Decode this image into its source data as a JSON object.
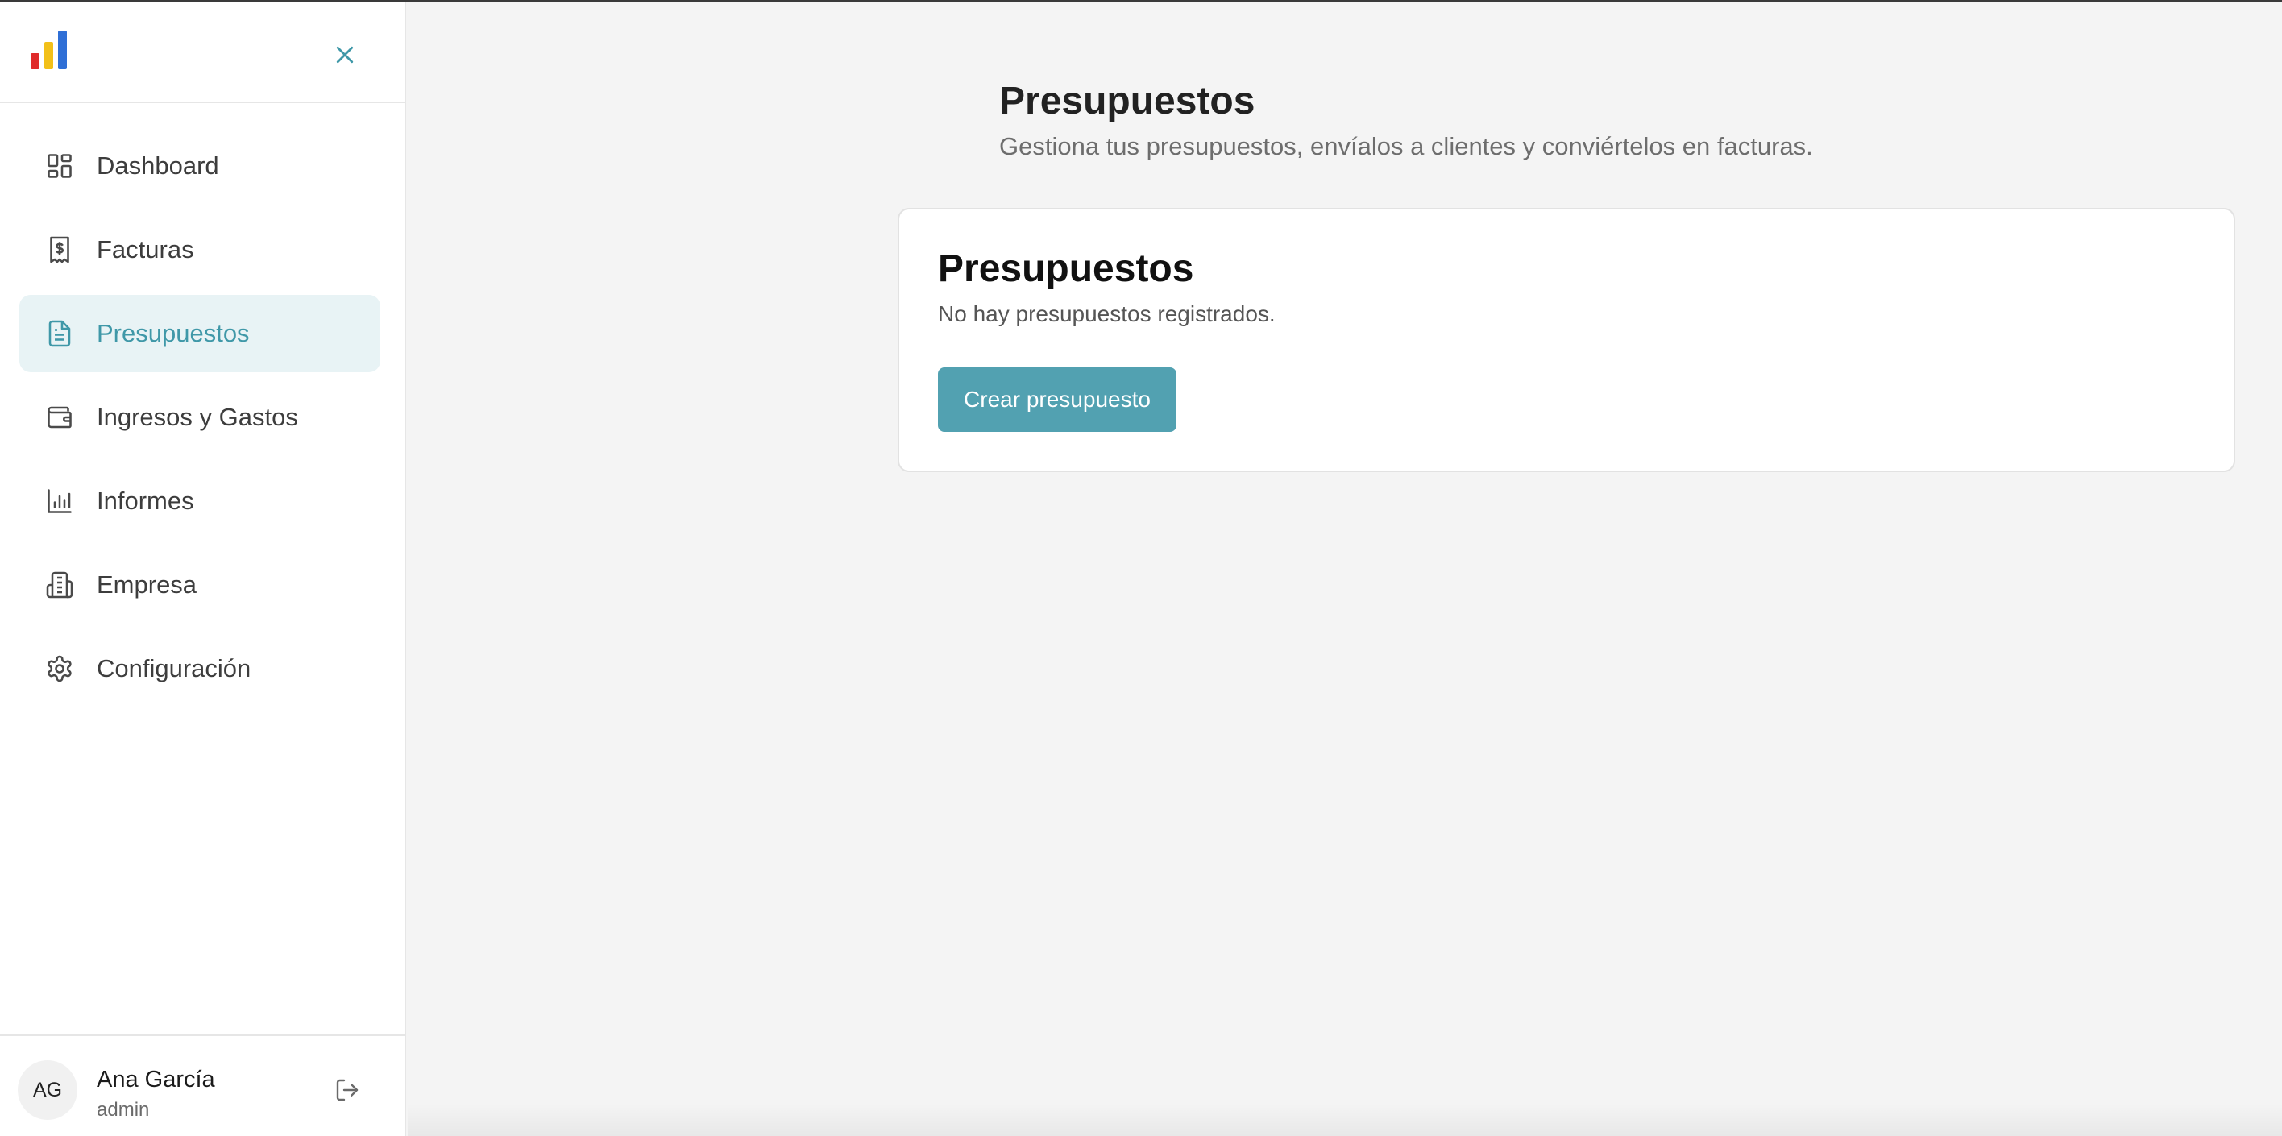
{
  "app": {
    "logo_icon": "bar-chart-logo",
    "close_icon": "close-icon",
    "accent_color": "#3f98a8",
    "button_color": "#52a1b1"
  },
  "sidebar": {
    "items": [
      {
        "label": "Dashboard",
        "icon": "dashboard-icon",
        "active": false
      },
      {
        "label": "Facturas",
        "icon": "invoice-dollar-icon",
        "active": false
      },
      {
        "label": "Presupuestos",
        "icon": "document-icon",
        "active": true
      },
      {
        "label": "Ingresos y Gastos",
        "icon": "wallet-icon",
        "active": false
      },
      {
        "label": "Informes",
        "icon": "bar-chart-icon",
        "active": false
      },
      {
        "label": "Empresa",
        "icon": "building-icon",
        "active": false
      },
      {
        "label": "Configuración",
        "icon": "gear-icon",
        "active": false
      }
    ]
  },
  "user": {
    "initials": "AG",
    "name": "Ana García",
    "role": "admin",
    "logout_icon": "logout-icon"
  },
  "main": {
    "title": "Presupuestos",
    "subtitle": "Gestiona tus presupuestos, envíalos a clientes y conviértelos en facturas.",
    "card": {
      "title": "Presupuestos",
      "empty_message": "No hay presupuestos registrados.",
      "create_button": "Crear presupuesto"
    }
  }
}
